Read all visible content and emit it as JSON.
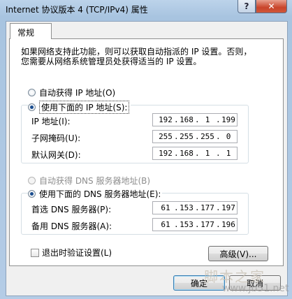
{
  "window": {
    "title": "Internet 协议版本 4 (TCP/IPv4) 属性",
    "help_label": "?",
    "close_label": "✕"
  },
  "tabs": [
    {
      "label": "常规"
    }
  ],
  "description": [
    "如果网络支持此功能，则可以获取自动指派的 IP 设置。否则，",
    "您需要从网络系统管理员处获得适当的 IP 设置。"
  ],
  "ip": {
    "auto_label": "自动获得 IP 地址(O)",
    "manual_label": "使用下面的 IP 地址(S):",
    "manual_selected": true,
    "fields": [
      {
        "label": "IP 地址(I):",
        "octets": [
          "192",
          "168",
          "1",
          "199"
        ]
      },
      {
        "label": "子网掩码(U):",
        "octets": [
          "255",
          "255",
          "255",
          "0"
        ]
      },
      {
        "label": "默认网关(D):",
        "octets": [
          "192",
          "168",
          "1",
          "1"
        ]
      }
    ]
  },
  "dns": {
    "auto_label": "自动获得 DNS 服务器地址(B)",
    "manual_label": "使用下面的 DNS 服务器地址(E):",
    "manual_selected": true,
    "fields": [
      {
        "label": "首选 DNS 服务器(P):",
        "octets": [
          "61",
          "153",
          "177",
          "197"
        ]
      },
      {
        "label": "备用 DNS 服务器(A):",
        "octets": [
          "61",
          "153",
          "177",
          "196"
        ]
      }
    ]
  },
  "validate_label": "退出时验证设置(L)",
  "validate_checked": false,
  "advanced_label": "高级(V)...",
  "ok_label": "确定",
  "cancel_label": "取消",
  "watermark": {
    "line1": "脚本之家",
    "line2": "www.jb51.net"
  }
}
